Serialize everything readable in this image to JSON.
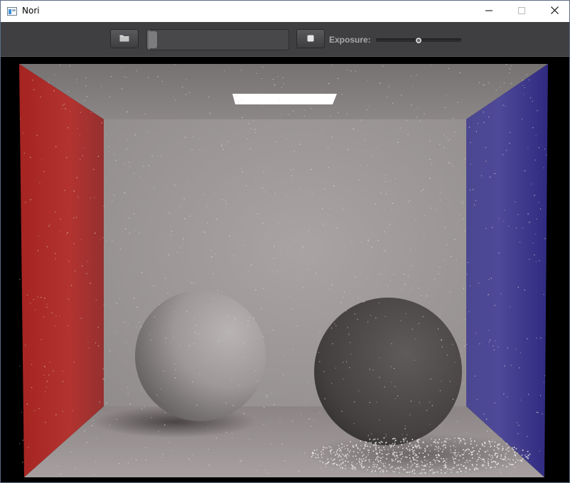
{
  "window": {
    "title": "Nori",
    "icons": {
      "app": "app-window-icon",
      "minimize": "minimize-icon",
      "maximize": "maximize-icon",
      "close": "close-icon"
    }
  },
  "toolbar": {
    "open_icon": "folder-open-icon",
    "stop_icon": "stop-icon",
    "progress": 0.02,
    "exposure_label": "Exposure:",
    "exposure_value": 0.5
  },
  "render": {
    "scene": "cornell-box",
    "colors": {
      "left_wall": "#b4322e",
      "right_wall": "#4f4aa4",
      "back_wall": "#9c9a9a",
      "light": "#ffffff"
    }
  }
}
